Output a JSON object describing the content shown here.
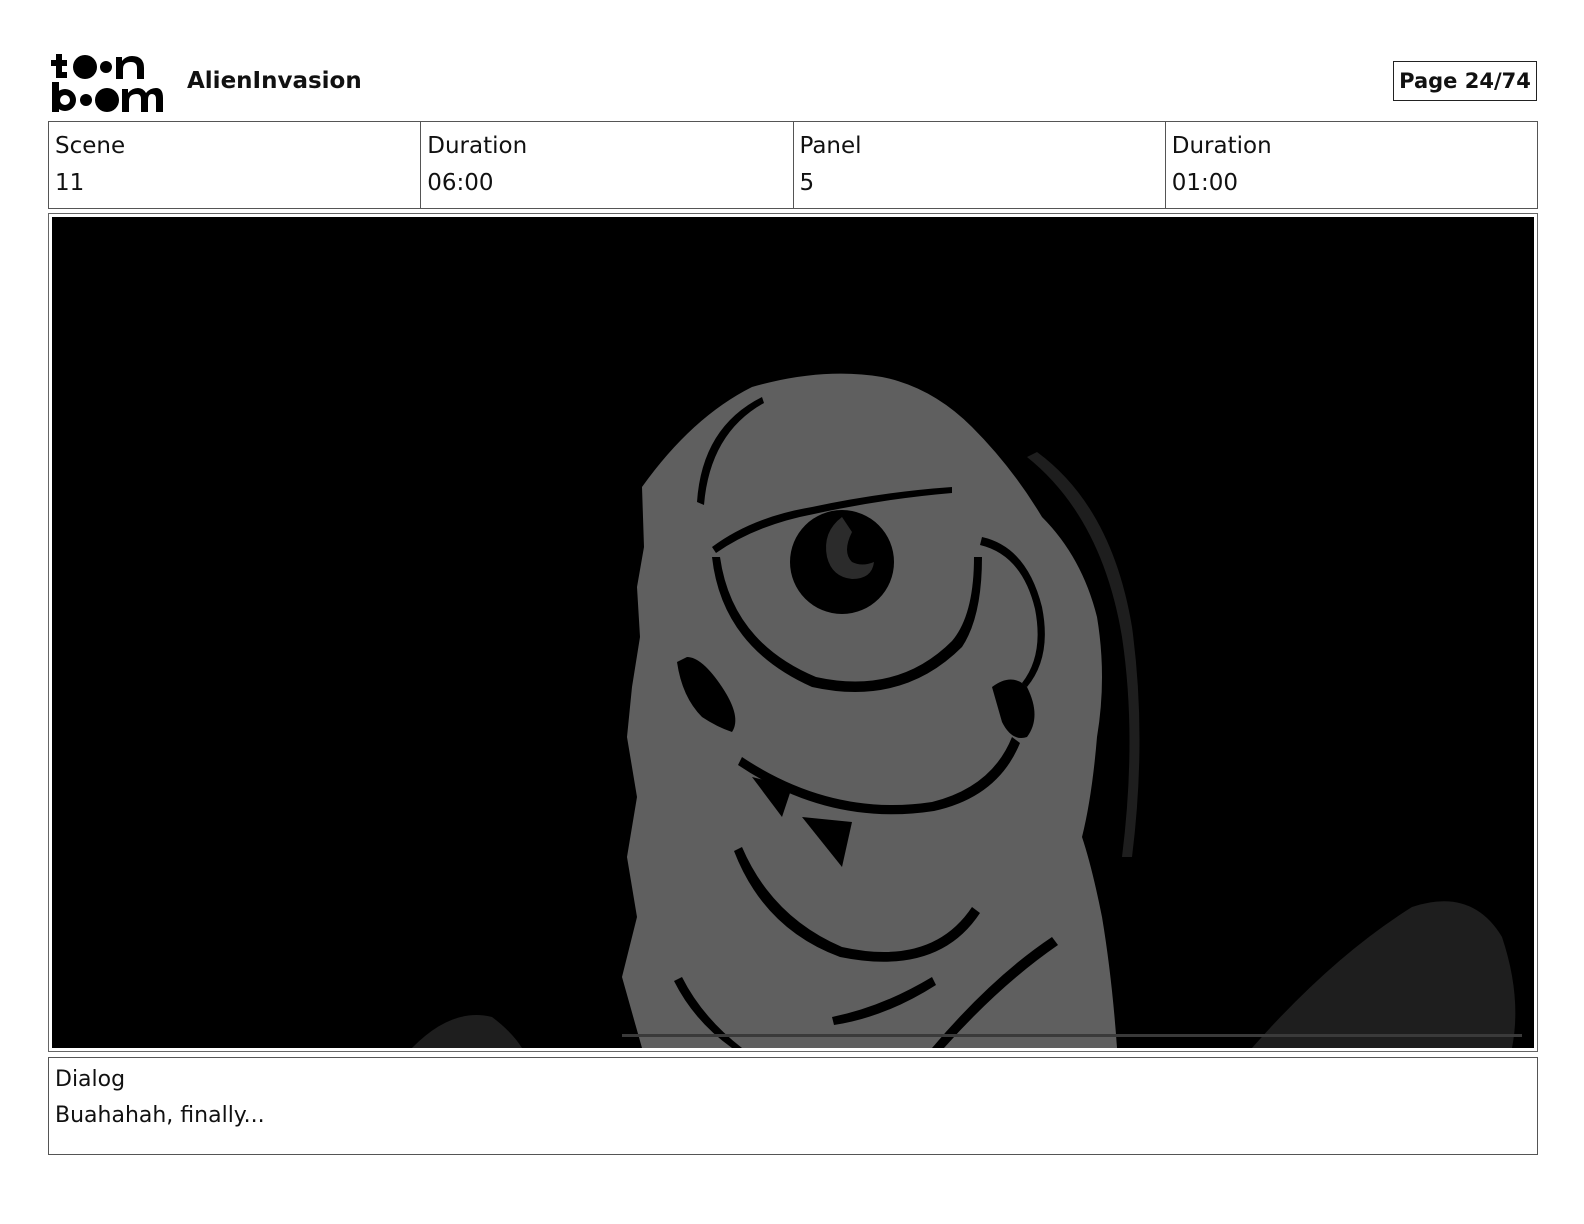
{
  "header": {
    "logo": {
      "line1": "toon",
      "line2": "boom"
    },
    "project_title": "AlienInvasion",
    "page_indicator": "Page 24/74"
  },
  "info": {
    "scene_label": "Scene",
    "scene_value": "11",
    "scene_duration_label": "Duration",
    "scene_duration_value": "06:00",
    "panel_label": "Panel",
    "panel_value": "5",
    "panel_duration_label": "Duration",
    "panel_duration_value": "01:00"
  },
  "dialog": {
    "label": "Dialog",
    "text": "Buahahah, finally..."
  },
  "colors": {
    "panel_background": "#000000",
    "character_fill": "#5f5f5f",
    "shadow_fill": "#1e1e1e"
  },
  "icons": {
    "logo": "toon-boom-logo"
  }
}
